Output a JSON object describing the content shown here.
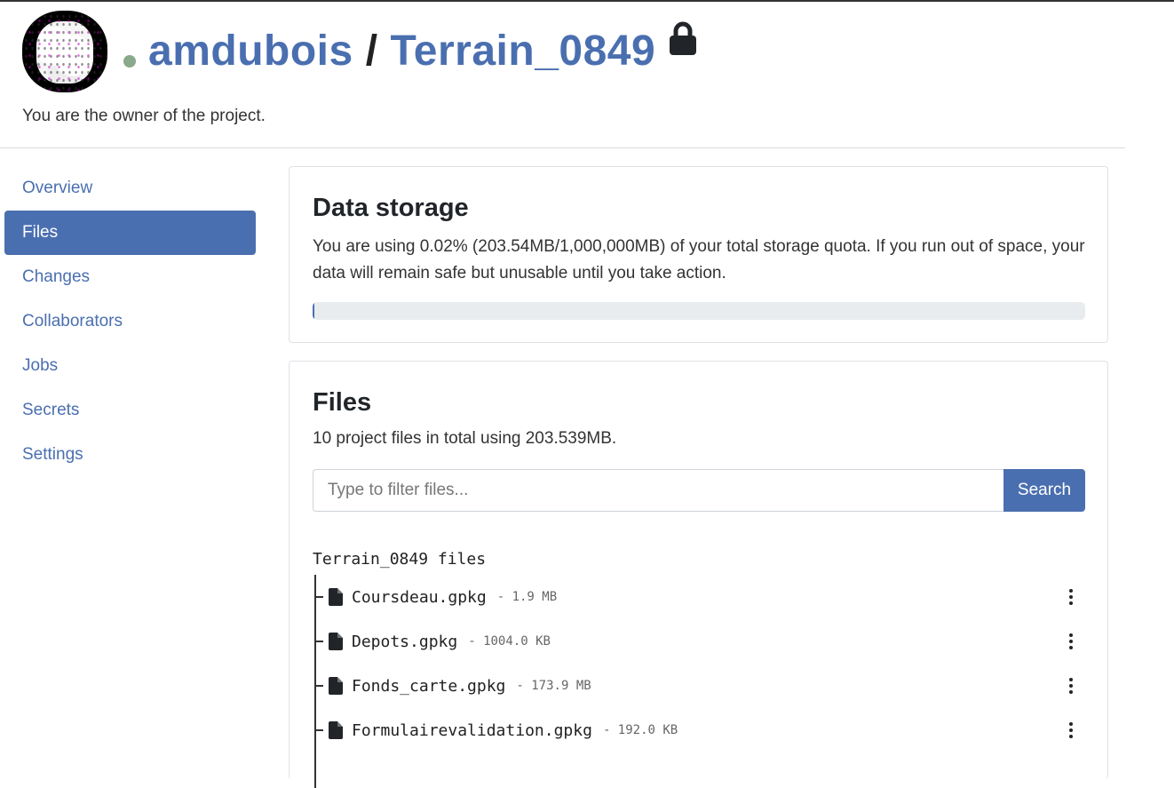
{
  "header": {
    "owner": "amdubois",
    "separator": "/",
    "project": "Terrain_0849",
    "owner_note": "You are the owner of the project."
  },
  "sidebar": {
    "items": [
      {
        "label": "Overview"
      },
      {
        "label": "Files"
      },
      {
        "label": "Changes"
      },
      {
        "label": "Collaborators"
      },
      {
        "label": "Jobs"
      },
      {
        "label": "Secrets"
      },
      {
        "label": "Settings"
      }
    ],
    "active": "Files"
  },
  "storage": {
    "title": "Data storage",
    "description": "You are using 0.02% (203.54MB/1,000,000MB) of your total storage quota. If you run out of space, your data will remain safe but unusable until you take action.",
    "used_percent": 0.02
  },
  "files": {
    "title": "Files",
    "summary": "10 project files in total using 203.539MB.",
    "filter_placeholder": "Type to filter files...",
    "search_label": "Search",
    "tree_root": "Terrain_0849 files",
    "items": [
      {
        "name": "Coursdeau.gpkg",
        "size": "- 1.9 MB"
      },
      {
        "name": "Depots.gpkg",
        "size": "- 1004.0 KB"
      },
      {
        "name": "Fonds_carte.gpkg",
        "size": "- 173.9 MB"
      },
      {
        "name": "Formulairevalidation.gpkg",
        "size": "- 192.0 KB"
      }
    ]
  },
  "colors": {
    "accent": "#4a6fb0",
    "presence": "#8aa88a"
  }
}
